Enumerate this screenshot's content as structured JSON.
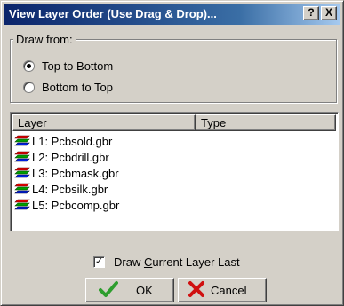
{
  "window": {
    "title": "View Layer Order (Use Drag & Drop)...",
    "help_label": "?",
    "close_label": "X"
  },
  "draw_from": {
    "legend": "Draw from:",
    "options": [
      {
        "label": "Top to Bottom",
        "selected": true
      },
      {
        "label": "Bottom to Top",
        "selected": false
      }
    ]
  },
  "layer_list": {
    "columns": [
      "Layer",
      "Type"
    ],
    "rows": [
      {
        "layer": "L1: Pcbsold.gbr",
        "type": ""
      },
      {
        "layer": "L2: Pcbdrill.gbr",
        "type": ""
      },
      {
        "layer": "L3: Pcbmask.gbr",
        "type": ""
      },
      {
        "layer": "L4: Pcbsilk.gbr",
        "type": ""
      },
      {
        "layer": "L5: Pcbcomp.gbr",
        "type": ""
      }
    ]
  },
  "options": {
    "draw_current_last": {
      "prefix": "Draw ",
      "mnemonic": "C",
      "suffix": "urrent Layer Last",
      "checked": true
    }
  },
  "buttons": {
    "ok_label": "OK",
    "cancel_label": "Cancel"
  },
  "icons": {
    "layer": "layer-stack-icon",
    "ok": "checkmark-icon",
    "cancel": "red-x-icon"
  }
}
